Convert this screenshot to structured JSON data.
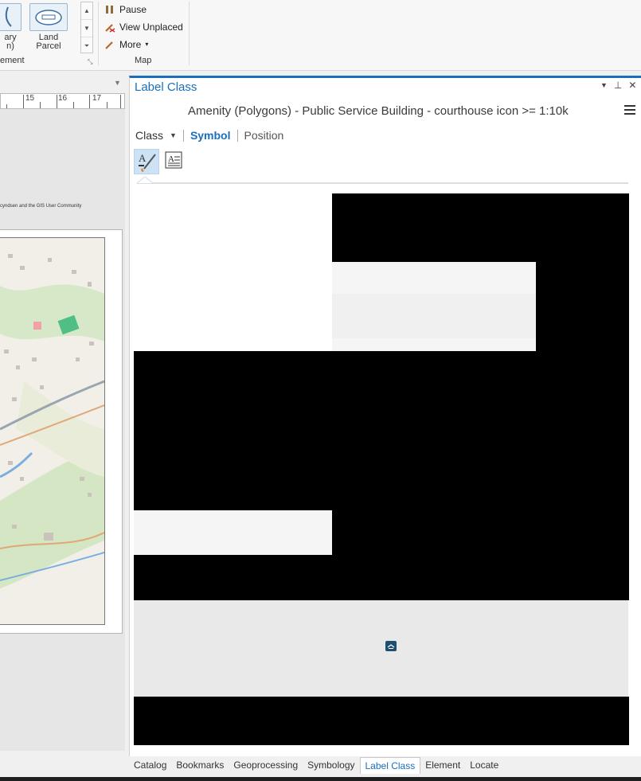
{
  "ribbon": {
    "buttons": {
      "boundary_partial": "ary\nn)",
      "land_parcel": "Land\nParcel"
    },
    "group_labels": {
      "placement": "ement",
      "map": "Map"
    },
    "map_group": {
      "pause": "Pause",
      "view_unplaced": "View Unplaced",
      "more": "More"
    }
  },
  "layout_view": {
    "ruler_labels": [
      "15",
      "16",
      "17"
    ],
    "credits_text": "cyndsen and the GIS User Community"
  },
  "label_class_pane": {
    "title": "Label Class",
    "subtitle": "Amenity (Polygons) - Public Service Building - courthouse icon >= 1:10k",
    "tabs": {
      "class": "Class",
      "symbol": "Symbol",
      "position": "Position"
    }
  },
  "bottom_tabs": [
    {
      "label": "Catalog"
    },
    {
      "label": "Bookmarks"
    },
    {
      "label": "Geoprocessing"
    },
    {
      "label": "Symbology"
    },
    {
      "label": "Label Class",
      "active": true
    },
    {
      "label": "Element"
    },
    {
      "label": "Locate"
    }
  ],
  "colors": {
    "accent": "#1a6fbd",
    "preview_glyph": "#1d4f73"
  },
  "icons": {
    "symbol_tool": "text-symbol-brush-icon",
    "text_tool": "text-format-icon",
    "preview_glyph": "courthouse-icon"
  }
}
